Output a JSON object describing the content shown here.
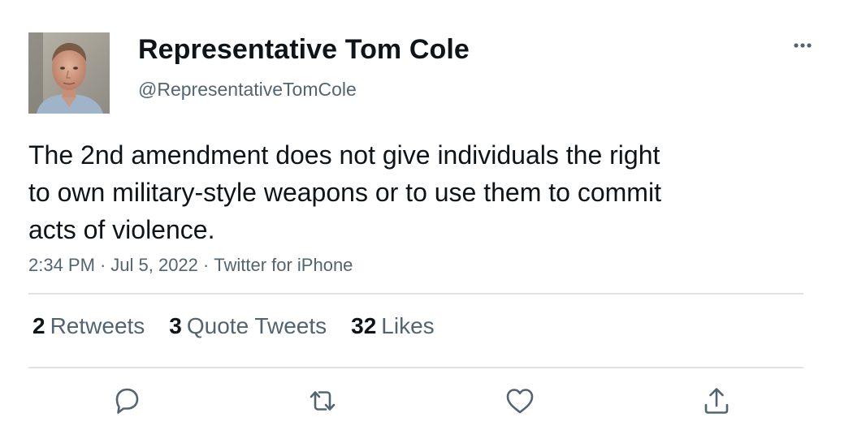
{
  "author": {
    "name": "Representative Tom Cole",
    "handle": "@RepresentativeTomCole",
    "avatar_icon": "profile-photo"
  },
  "tweet": {
    "text": "The 2nd amendment does not give individuals the right\nto own military-style weapons or to use them to commit\nacts of violence.",
    "time": "2:34 PM",
    "date": "Jul 5, 2022",
    "source": "Twitter for iPhone",
    "separator": "·"
  },
  "stats": {
    "retweets_count": "2",
    "retweets_label": "Retweets",
    "quotes_count": "3",
    "quotes_label": "Quote Tweets",
    "likes_count": "32",
    "likes_label": "Likes"
  },
  "actions": {
    "icons": [
      "reply-icon",
      "retweet-icon",
      "like-icon",
      "share-icon"
    ],
    "more_icon": "more-options-icon"
  },
  "colors": {
    "text_primary": "#0f1419",
    "text_secondary": "#536471",
    "divider": "#dfe3e6",
    "icon": "#536471"
  }
}
